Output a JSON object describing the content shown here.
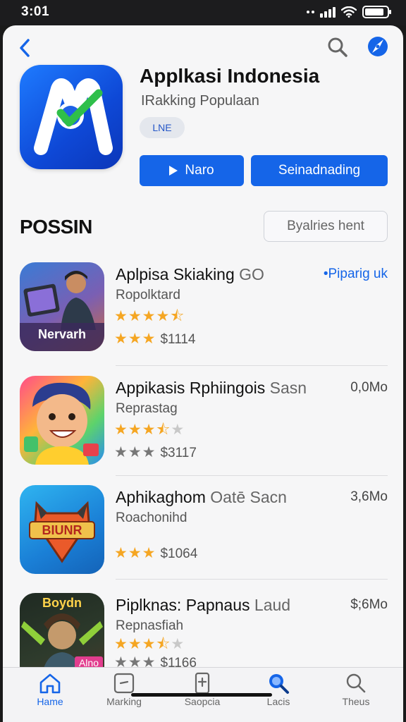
{
  "status": {
    "time": "3:01",
    "battery_level": 0.85
  },
  "header": {
    "back_icon": "chevron-left-icon",
    "search_icon": "search-icon",
    "compass_icon": "compass-icon"
  },
  "app": {
    "title": "Applkasi Indonesia",
    "subtitle": "IRakking Populaan",
    "badge": "LNE",
    "open_label": "Naro",
    "download_label": "Seinadnading",
    "colors": {
      "accent": "#1565e8",
      "icon_bg": "#0e48d6",
      "check": "#2fbf4a"
    }
  },
  "section": {
    "title": "POSSIN",
    "see_all": "Byalries hent"
  },
  "list": [
    {
      "title": "Aplpisa Skiaking",
      "title_suffix": "GO",
      "category": "Ropolktard",
      "side": "•Piparig uk",
      "rating": 4.5,
      "price_stars": 3,
      "price": "$1114"
    },
    {
      "title": "Appikasis Rphiingois",
      "title_suffix": "Sasn",
      "category": "Reprastag",
      "side": "0,0Mo",
      "rating": 3.5,
      "price_stars": 3,
      "price": "$3117"
    },
    {
      "title": "Aphikaghom",
      "title_suffix": "Oatē Sacn",
      "category": "Roachonihd",
      "side": "3,6Mo",
      "rating": 3,
      "price_stars": 3,
      "price": "$1064"
    },
    {
      "title": "Piplknas: Papnaus",
      "title_suffix": "Laud",
      "category": "Repnasfiah",
      "side": "$;6Mo",
      "rating": 3.5,
      "price_stars": 3,
      "price": "$1166"
    }
  ],
  "thumbnails": {
    "row1_label": "Nervarh",
    "row3_label": "BIUNR",
    "row4_top": "Boydn",
    "row4_tag": "Alno"
  },
  "tabs": [
    {
      "label": "Hame",
      "icon": "home-icon",
      "active": true
    },
    {
      "label": "Marking",
      "icon": "marking-icon",
      "active": false
    },
    {
      "label": "Saopcia",
      "icon": "phone-icon",
      "active": false
    },
    {
      "label": "Lacis",
      "icon": "lacis-search-icon",
      "active": false
    },
    {
      "label": "Theus",
      "icon": "search-icon",
      "active": false
    }
  ]
}
